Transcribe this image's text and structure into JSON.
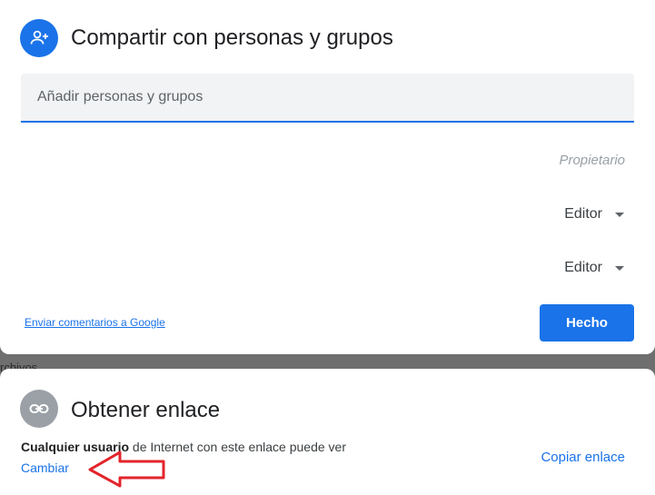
{
  "share_dialog": {
    "title": "Compartir con personas y grupos",
    "add_people_placeholder": "Añadir personas y grupos",
    "owner_role": "Propietario",
    "editor_roles": [
      "Editor",
      "Editor"
    ],
    "feedback_link": "Enviar comentarios a Google",
    "done_button": "Hecho",
    "icons": {
      "header": "person-add-icon",
      "dropdown": "caret-down-icon"
    },
    "colors": {
      "accent": "#1a73e8"
    }
  },
  "background": {
    "partial_text": "rchivos"
  },
  "link_dialog": {
    "title": "Obtener enlace",
    "access_who": "Cualquier usuario",
    "access_rest": " de Internet con este enlace puede ver",
    "change_link": "Cambiar",
    "copy_link": "Copiar enlace",
    "icons": {
      "header": "link-icon"
    }
  },
  "annotation": {
    "type": "red-arrow",
    "color": "#e3242b",
    "points_to": "Cambiar"
  }
}
